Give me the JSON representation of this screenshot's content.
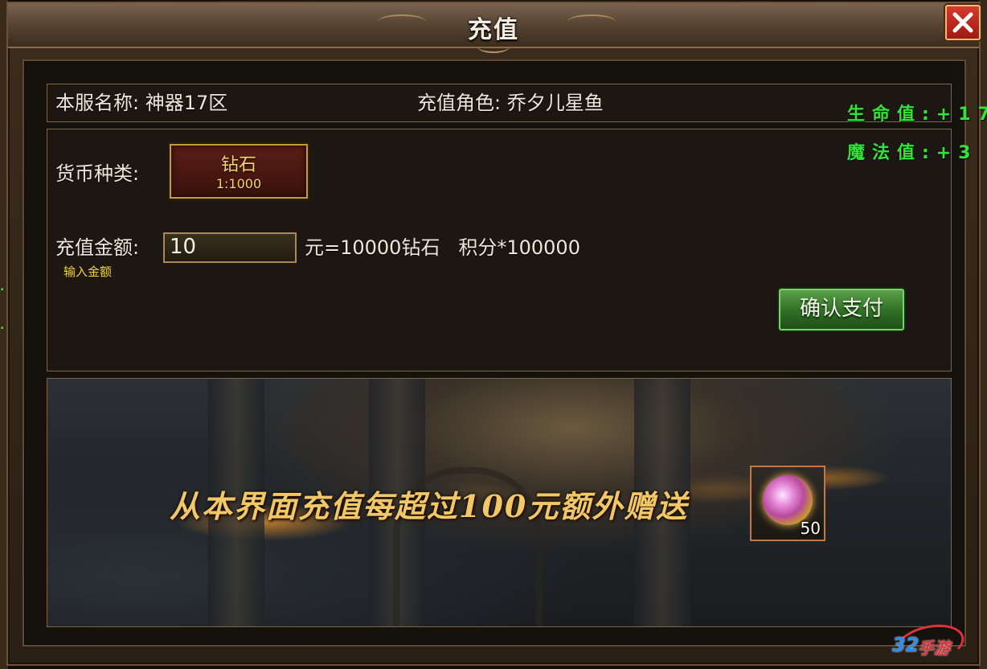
{
  "window": {
    "title": "充值",
    "close_label": "close"
  },
  "info_bar": {
    "server": "本服名称: 神器17区",
    "role": "充值角色: 乔夕儿星鱼"
  },
  "form": {
    "currency_label": "货币种类:",
    "currency": {
      "name": "钻石",
      "rate": "1:1000"
    },
    "amount_label": "充值金额:",
    "amount_value": "10",
    "amount_hint": "输入金额",
    "amount_result": "元=10000钻石   积分*100000",
    "confirm_label": "确认支付"
  },
  "banner": {
    "text": "从本界面充值每超过100元额外赠送",
    "reward_count": "50",
    "reward_icon": "orb-icon"
  },
  "overlay": {
    "hp_stat": "生命值:+17",
    "mp_stat": "魔法值:+3",
    "side_marks": [
      ".",
      "."
    ]
  },
  "watermark": {
    "number": "32",
    "text": "手游"
  },
  "colors": {
    "stat_green": "#34e33a",
    "gold": "#f7d66a",
    "confirm_green": "#2f6f25",
    "close_red": "#c62a20"
  }
}
